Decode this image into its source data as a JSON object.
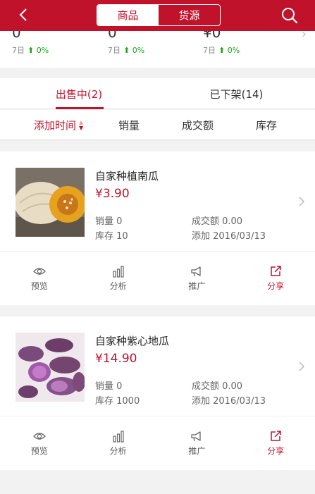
{
  "header": {
    "segments": [
      "商品",
      "货源"
    ],
    "active_segment": 0
  },
  "stats": [
    {
      "value": "0",
      "period": "7日",
      "change": "0%"
    },
    {
      "value": "0",
      "period": "7日",
      "change": "0%"
    },
    {
      "value": "¥0",
      "period": "7日",
      "change": "0%"
    }
  ],
  "tabs": [
    {
      "label": "出售中(2)",
      "active": true
    },
    {
      "label": "已下架(14)",
      "active": false
    }
  ],
  "sort": {
    "items": [
      "添加时间",
      "销量",
      "成交额",
      "库存"
    ],
    "active": 0
  },
  "products": [
    {
      "name": "自家种植南瓜",
      "price": "¥3.90",
      "sales": "销量 0",
      "revenue": "成交额 0.00",
      "stock": "库存 10",
      "added": "添加 2016/03/13"
    },
    {
      "name": "自家种紫心地瓜",
      "price": "¥14.90",
      "sales": "销量 0",
      "revenue": "成交额 0.00",
      "stock": "库存 1000",
      "added": "添加 2016/03/13"
    }
  ],
  "actions": [
    "预览",
    "分析",
    "推广",
    "分享"
  ],
  "colors": {
    "accent": "#c0122b",
    "up": "#19a619",
    "background": "#f2f2f2"
  }
}
